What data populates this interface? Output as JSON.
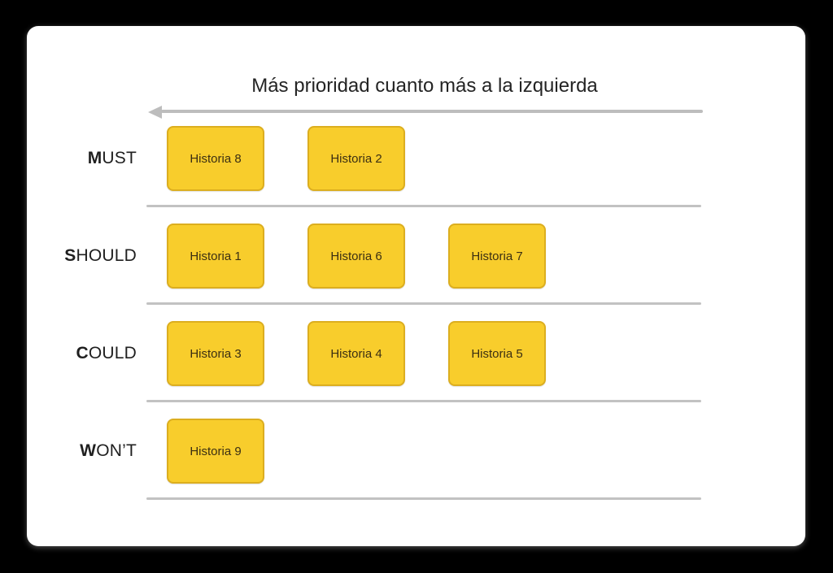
{
  "board": {
    "axis_title": "Más prioridad cuanto más a la izquierda",
    "arrow_direction": "left",
    "arrow_color": "#bdbdbd",
    "separator_color": "#c2c2c2",
    "card_fill": "#f8cd2c",
    "card_border": "#dcae1f",
    "card_text_color": "#3b2f12",
    "panel_color": "#ffffff",
    "background_color": "#000000"
  },
  "rows": [
    {
      "initial": "M",
      "rest": "UST",
      "full_label": "MUST",
      "cards": [
        {
          "label": "Historia 8"
        },
        {
          "label": "Historia 2"
        }
      ]
    },
    {
      "initial": "S",
      "rest": "HOULD",
      "full_label": "SHOULD",
      "cards": [
        {
          "label": "Historia 1"
        },
        {
          "label": "Historia 6"
        },
        {
          "label": "Historia 7"
        }
      ]
    },
    {
      "initial": "C",
      "rest": "OULD",
      "full_label": "COULD",
      "cards": [
        {
          "label": "Historia 3"
        },
        {
          "label": "Historia 4"
        },
        {
          "label": "Historia 5"
        }
      ]
    },
    {
      "initial": "W",
      "rest": "ON’T",
      "full_label": "WON’T",
      "cards": [
        {
          "label": "Historia 9"
        }
      ]
    }
  ]
}
